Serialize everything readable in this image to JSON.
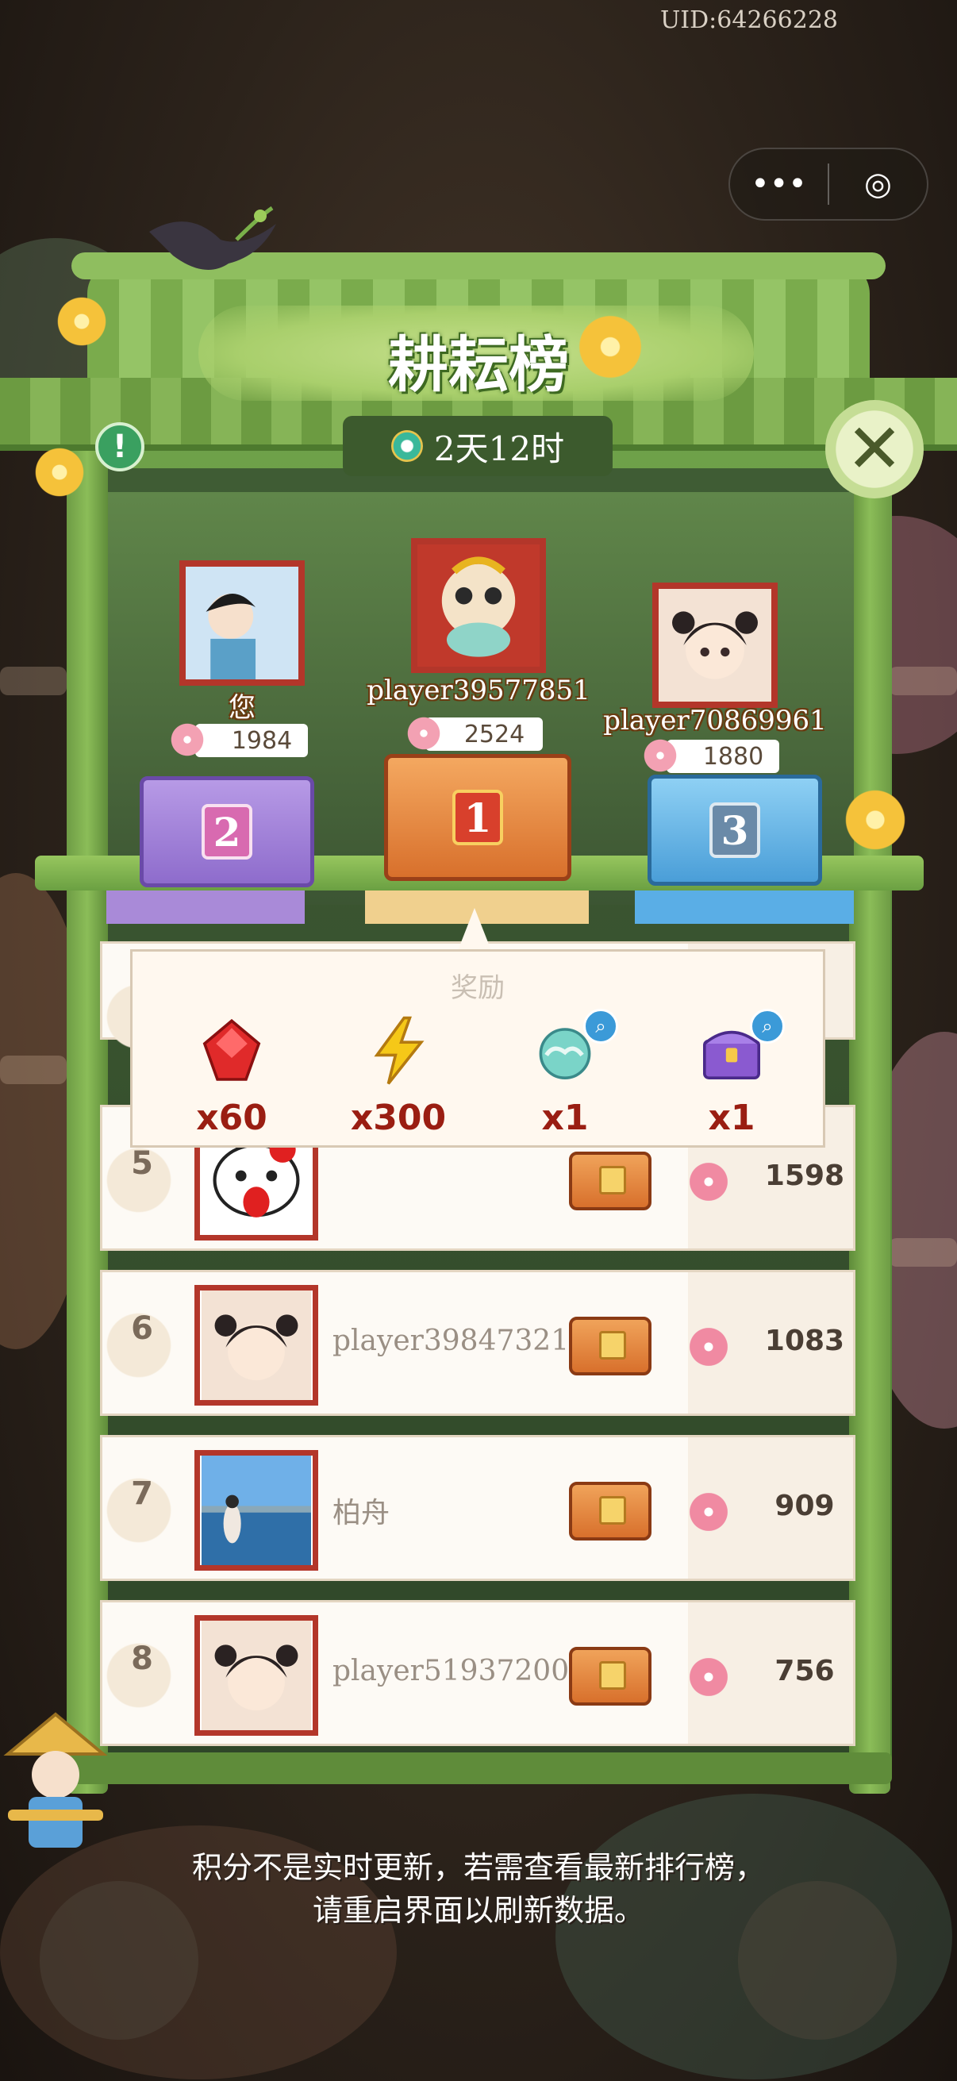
{
  "status": {
    "uid": "UID:64266228",
    "menu_icon": "more-dots-icon",
    "target_icon": "target-icon"
  },
  "board": {
    "title": "耕耘榜",
    "timer": "2天12时",
    "info_icon": "info-icon",
    "close_icon": "close-icon"
  },
  "podium": [
    {
      "place": "2",
      "name": "您",
      "score": "1984"
    },
    {
      "place": "1",
      "name": "player39577851",
      "score": "2524"
    },
    {
      "place": "3",
      "name": "player70869961",
      "score": "1880"
    }
  ],
  "reward": {
    "title": "奖励",
    "items": [
      {
        "icon": "ruby-gem-icon",
        "qty": "x60"
      },
      {
        "icon": "lightning-energy-icon",
        "qty": "x300"
      },
      {
        "icon": "cloud-orb-icon",
        "qty": "x1"
      },
      {
        "icon": "purple-chest-icon",
        "qty": "x1"
      }
    ]
  },
  "rows": [
    {
      "rank": "5",
      "name": "",
      "score": "1598"
    },
    {
      "rank": "6",
      "name": "player39847321",
      "score": "1083"
    },
    {
      "rank": "7",
      "name": "柏舟",
      "score": "909"
    },
    {
      "rank": "8",
      "name": "player51937200",
      "score": "756"
    }
  ],
  "footnote": {
    "line1": "积分不是实时更新，若需查看最新排行榜，",
    "line2": "请重启界面以刷新数据。"
  },
  "colors": {
    "frame_green": "#6fa24a",
    "avatar_border": "#b3362a",
    "reward_qty": "#9a1e12",
    "podium_1": "#f0a35a",
    "podium_2": "#a98ad8",
    "podium_3": "#5aaee6"
  }
}
